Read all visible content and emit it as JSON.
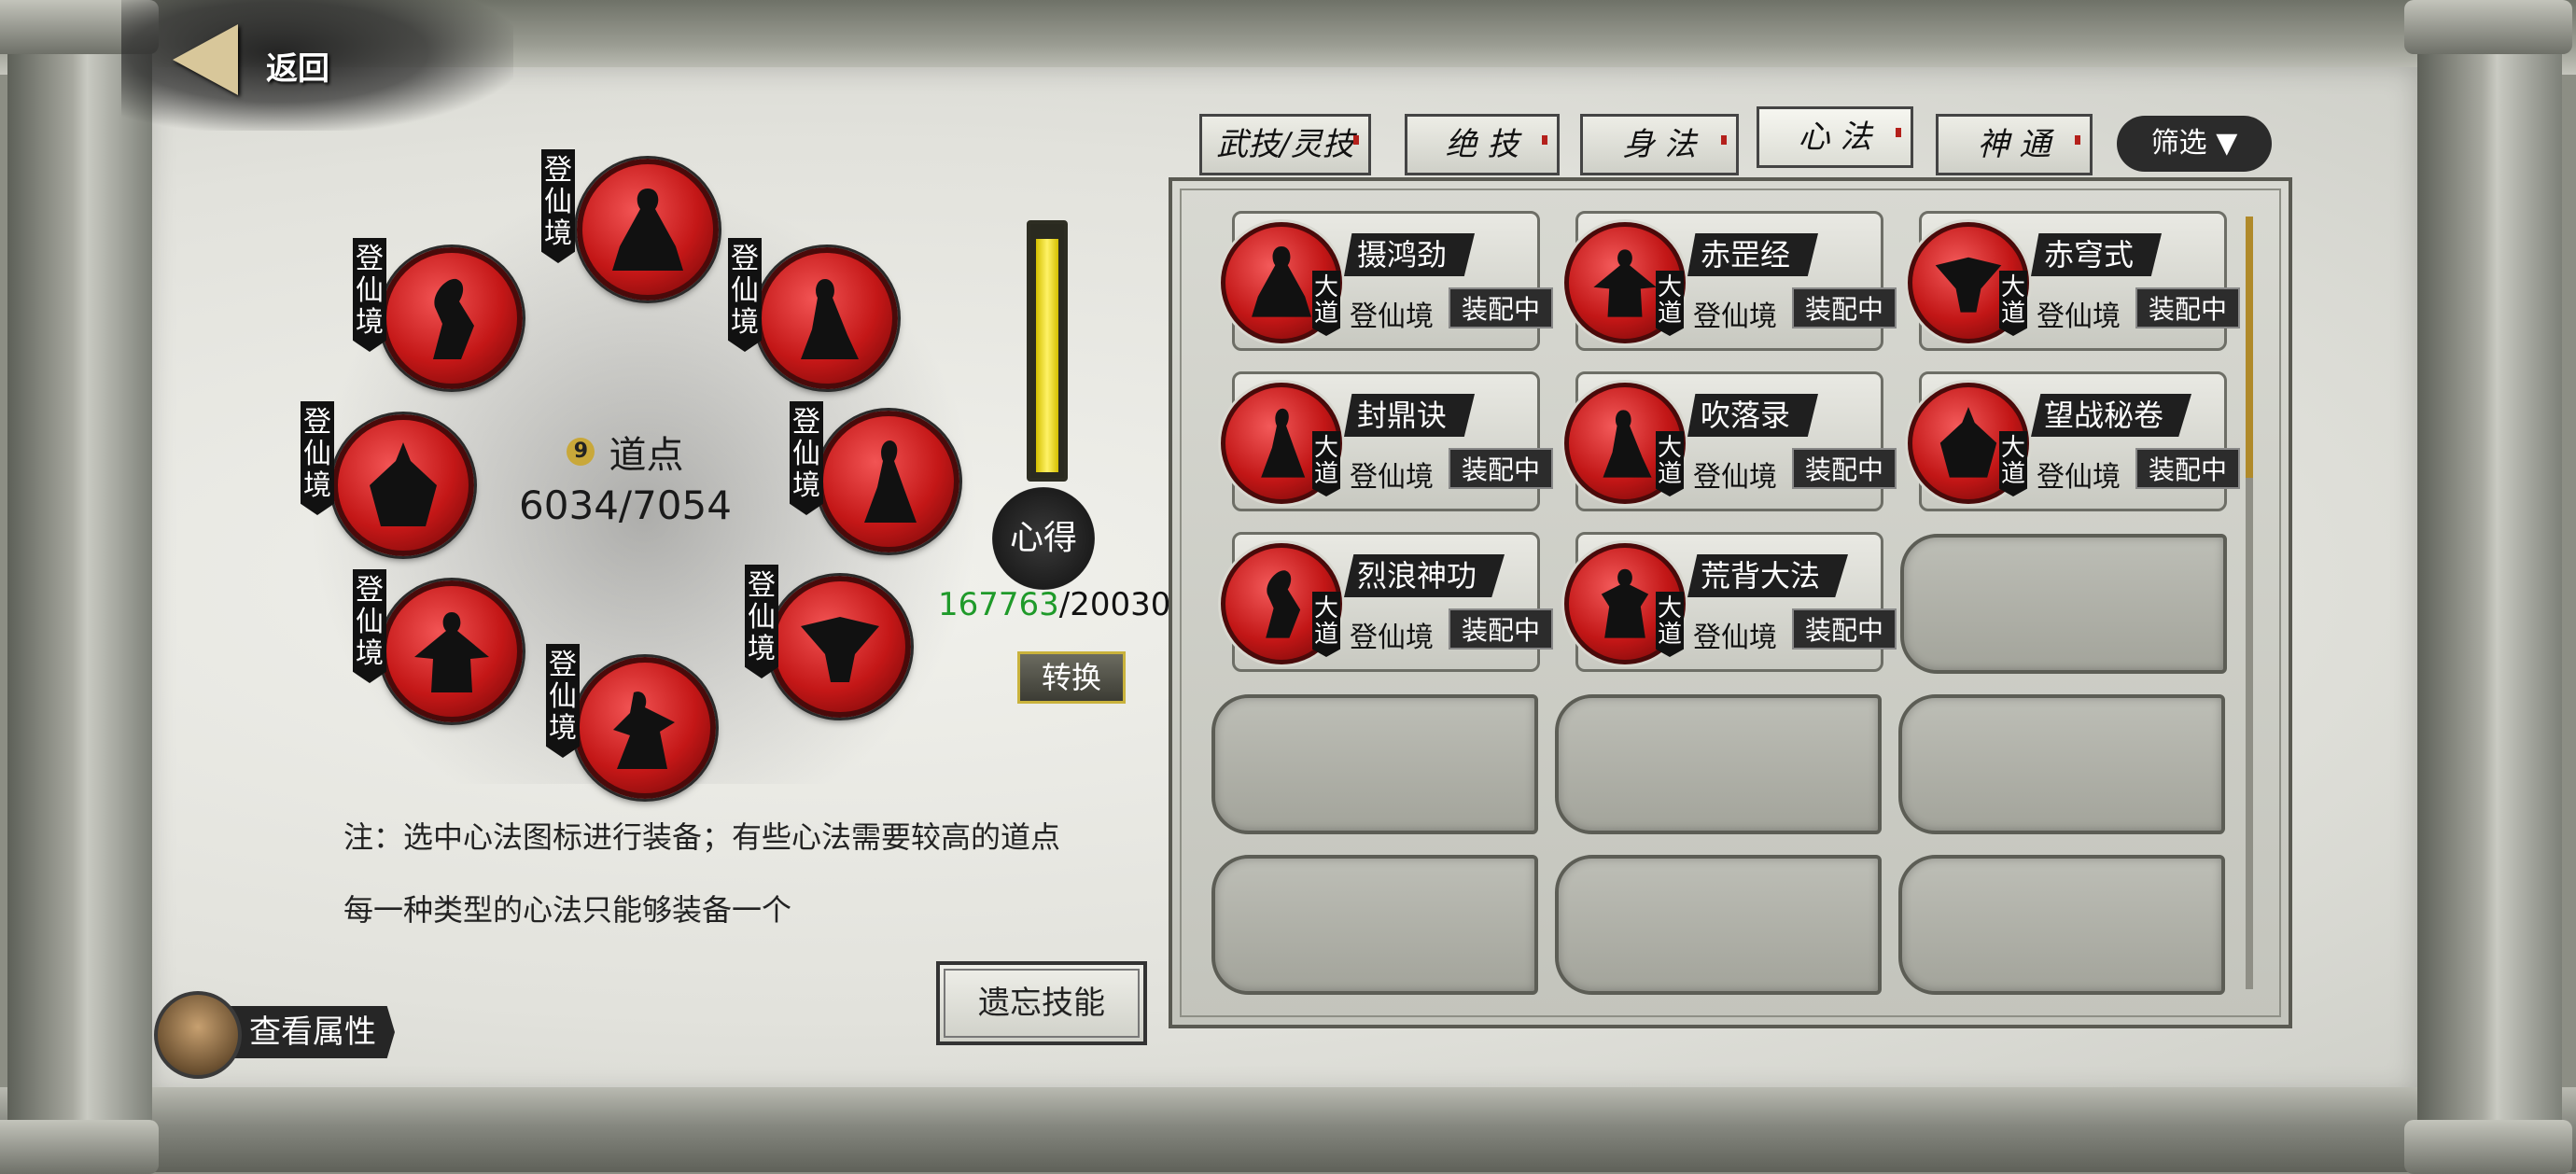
{
  "back": {
    "label": "返回"
  },
  "slots": [
    {
      "tag": "登仙境"
    },
    {
      "tag": "登仙境"
    },
    {
      "tag": "登仙境"
    },
    {
      "tag": "登仙境"
    },
    {
      "tag": "登仙境"
    },
    {
      "tag": "登仙境"
    },
    {
      "tag": "登仙境"
    },
    {
      "tag": "登仙境"
    }
  ],
  "dao": {
    "coin": "9",
    "label": "道点",
    "value": "6034/7054"
  },
  "xinde": {
    "label": "心得",
    "current": "167763",
    "sep_total": "/20030",
    "convert_label": "转换"
  },
  "notes": {
    "line1": "注：选中心法图标进行装备；有些心法需要较高的道点",
    "line2": "每一种类型的心法只能够装备一个"
  },
  "forget_label": "遗忘技能",
  "attr_label": "查看属性",
  "tabs": [
    {
      "label": "武技/灵技"
    },
    {
      "label": "绝 技"
    },
    {
      "label": "身 法"
    },
    {
      "label": "心 法"
    },
    {
      "label": "神 通"
    }
  ],
  "filter_label": "筛选 ▼",
  "skills": [
    {
      "name": "摄鸿劲",
      "dadao": "大道",
      "realm": "登仙境",
      "status": "装配中"
    },
    {
      "name": "赤罡经",
      "dadao": "大道",
      "realm": "登仙境",
      "status": "装配中"
    },
    {
      "name": "赤穹式",
      "dadao": "大道",
      "realm": "登仙境",
      "status": "装配中"
    },
    {
      "name": "封鼎诀",
      "dadao": "大道",
      "realm": "登仙境",
      "status": "装配中"
    },
    {
      "name": "吹落录",
      "dadao": "大道",
      "realm": "登仙境",
      "status": "装配中"
    },
    {
      "name": "望战秘卷",
      "dadao": "大道",
      "realm": "登仙境",
      "status": "装配中"
    },
    {
      "name": "烈浪神功",
      "dadao": "大道",
      "realm": "登仙境",
      "status": "装配中"
    },
    {
      "name": "荒背大法",
      "dadao": "大道",
      "realm": "登仙境",
      "status": "装配中"
    }
  ],
  "colors": {
    "accent_red": "#c41717",
    "gauge_yellow": "#fff266",
    "xinde_green": "#1f9a2a"
  }
}
